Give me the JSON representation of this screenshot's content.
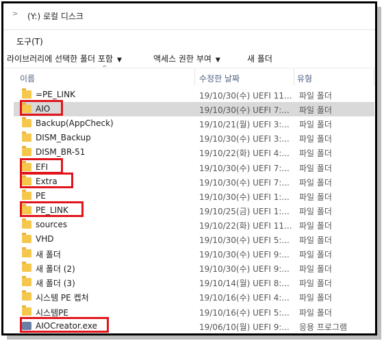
{
  "address": {
    "path": "(Y:) 로컬 디스크"
  },
  "menu": {
    "tools": "도구(T)"
  },
  "commands": [
    {
      "label": "라이브러리에 선택한 폴더 포함",
      "caret": "▼"
    },
    {
      "label": "액세스 권한 부여",
      "caret": "▼"
    },
    {
      "label": "새 폴더",
      "caret": ""
    }
  ],
  "columns": {
    "name": "이름",
    "date": "수정한 날짜",
    "type": "유형",
    "sort_indicator": "^"
  },
  "files": [
    {
      "name": "=PE_LINK",
      "date": "19/10/30(수) UEFI 11...",
      "type": "파일 폴더",
      "icon": "folder-icon",
      "selected": false,
      "highlighted": false
    },
    {
      "name": "AIO",
      "date": "19/10/30(수) UEFI 7:...",
      "type": "파일 폴더",
      "icon": "folder-icon",
      "selected": true,
      "highlighted": true
    },
    {
      "name": "Backup(AppCheck)",
      "date": "19/10/21(월) UEFI 3:...",
      "type": "파일 폴더",
      "icon": "folder-icon",
      "selected": false,
      "highlighted": false
    },
    {
      "name": "DISM_Backup",
      "date": "19/10/30(수) UEFI 3:...",
      "type": "파일 폴더",
      "icon": "folder-icon",
      "selected": false,
      "highlighted": false
    },
    {
      "name": "DISM_BR-51",
      "date": "19/10/22(화) UEFI 4:...",
      "type": "파일 폴더",
      "icon": "folder-icon",
      "selected": false,
      "highlighted": false
    },
    {
      "name": "EFI",
      "date": "19/10/30(수) UEFI 7:...",
      "type": "파일 폴더",
      "icon": "folder-icon",
      "selected": false,
      "highlighted": true
    },
    {
      "name": "Extra",
      "date": "19/10/30(수) UEFI 7:...",
      "type": "파일 폴더",
      "icon": "folder-icon",
      "selected": false,
      "highlighted": true
    },
    {
      "name": "PE",
      "date": "19/10/30(수) UEFI 1:...",
      "type": "파일 폴더",
      "icon": "folder-icon",
      "selected": false,
      "highlighted": false
    },
    {
      "name": "PE_LINK",
      "date": "19/10/25(금) UEFI 1:...",
      "type": "파일 폴더",
      "icon": "folder-icon",
      "selected": false,
      "highlighted": true
    },
    {
      "name": "sources",
      "date": "19/10/22(화) UEFI 11...",
      "type": "파일 폴더",
      "icon": "folder-icon",
      "selected": false,
      "highlighted": false
    },
    {
      "name": "VHD",
      "date": "19/10/30(수) UEFI 5:...",
      "type": "파일 폴더",
      "icon": "folder-icon",
      "selected": false,
      "highlighted": false
    },
    {
      "name": "새 폴더",
      "date": "19/10/30(수) UEFI 9:...",
      "type": "파일 폴더",
      "icon": "folder-icon",
      "selected": false,
      "highlighted": false
    },
    {
      "name": "새 폴더 (2)",
      "date": "19/10/30(수) UEFI 9:...",
      "type": "파일 폴더",
      "icon": "folder-icon",
      "selected": false,
      "highlighted": false
    },
    {
      "name": "새 폴더 (3)",
      "date": "19/10/14(월) UEFI 8:...",
      "type": "파일 폴더",
      "icon": "folder-icon",
      "selected": false,
      "highlighted": false
    },
    {
      "name": "시스템 PE 켑처",
      "date": "19/10/16(수) UEFI 4:...",
      "type": "파일 폴더",
      "icon": "folder-icon",
      "selected": false,
      "highlighted": false
    },
    {
      "name": "시스템PE",
      "date": "19/10/16(수) UEFI 5:...",
      "type": "파일 폴더",
      "icon": "folder-icon",
      "selected": false,
      "highlighted": false
    },
    {
      "name": "AIOCreator.exe",
      "date": "19/06/10(월) UEFI 9:...",
      "type": "응용 프로그램",
      "icon": "application-icon",
      "selected": false,
      "highlighted": true
    }
  ],
  "colors": {
    "highlight": "#e0141b",
    "selected_row": "#d9d9d9",
    "folder": "#f5c74d",
    "header_text": "#4d6082"
  }
}
